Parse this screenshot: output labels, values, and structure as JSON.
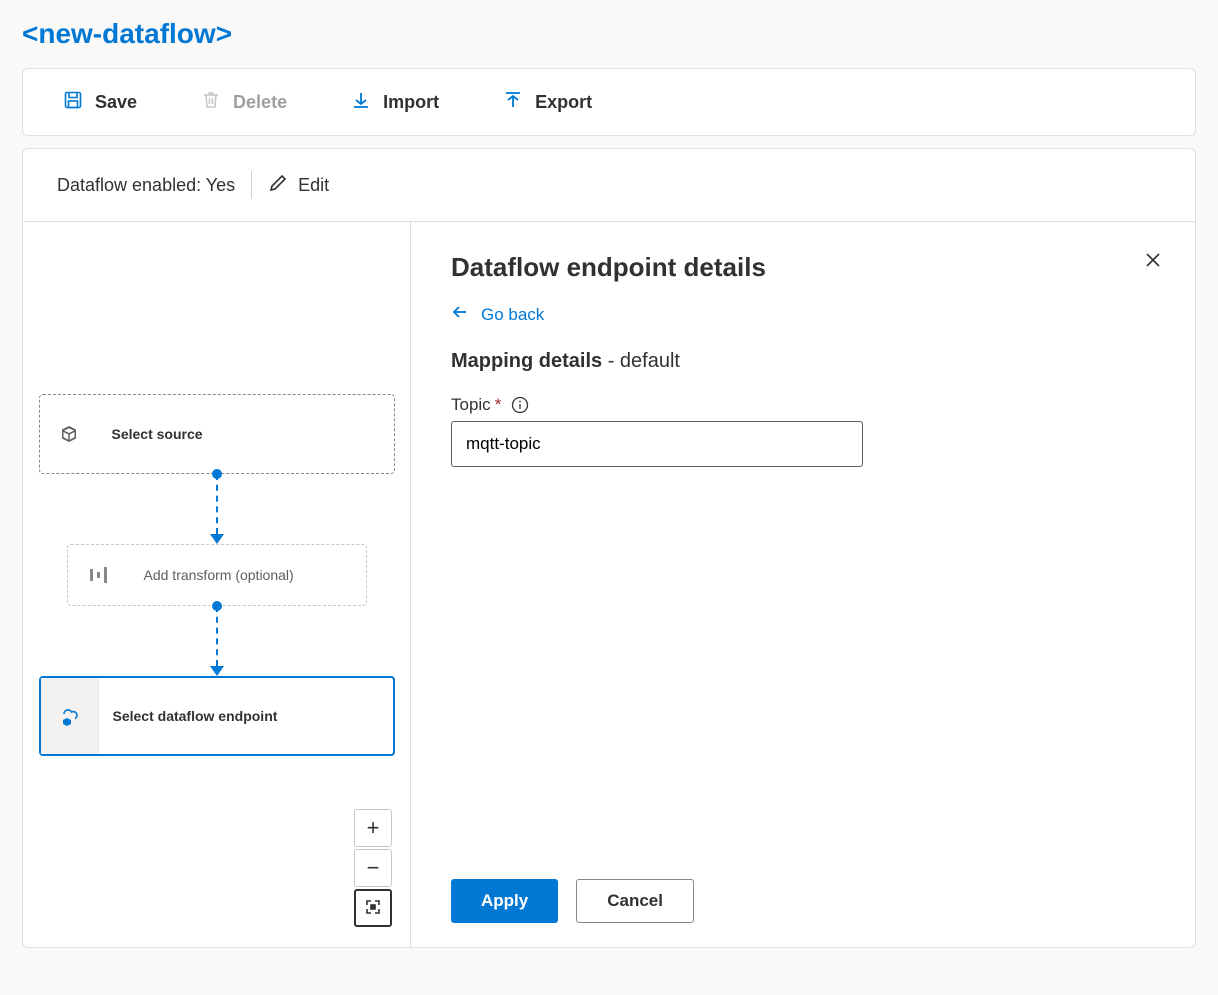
{
  "header": {
    "title": "<new-dataflow>"
  },
  "toolbar": {
    "save_label": "Save",
    "delete_label": "Delete",
    "import_label": "Import",
    "export_label": "Export"
  },
  "status": {
    "text": "Dataflow enabled: Yes",
    "edit_label": "Edit"
  },
  "flow": {
    "source_label": "Select source",
    "transform_label": "Add transform (optional)",
    "endpoint_label": "Select dataflow endpoint"
  },
  "details": {
    "title": "Dataflow endpoint details",
    "go_back_label": "Go back",
    "mapping_label": "Mapping details",
    "mapping_value": "default",
    "topic_label": "Topic",
    "topic_value": "mqtt-topic",
    "apply_label": "Apply",
    "cancel_label": "Cancel"
  }
}
